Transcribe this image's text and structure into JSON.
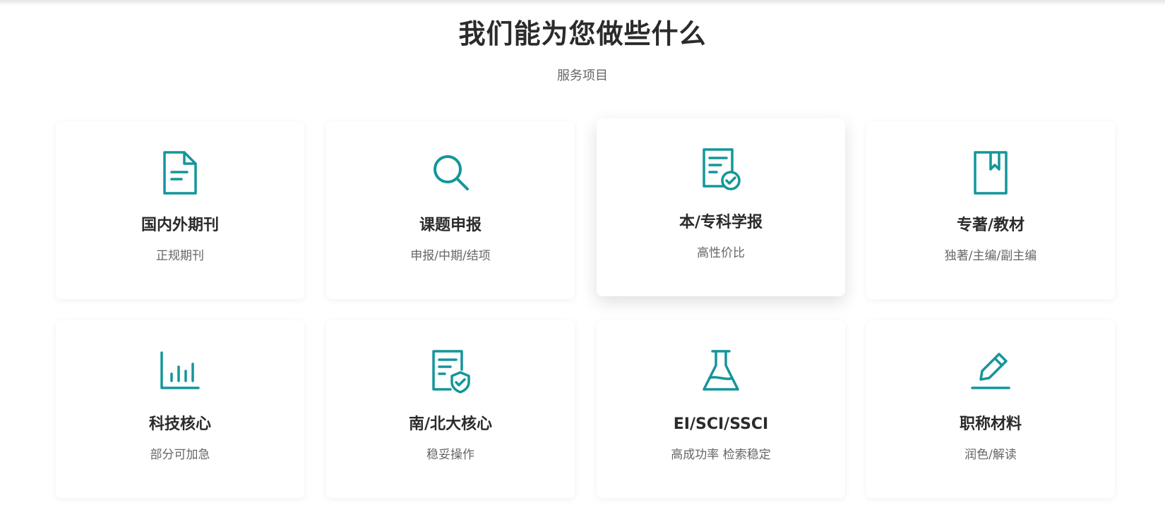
{
  "section": {
    "title": "我们能为您做些什么",
    "subtitle": "服务项目"
  },
  "accent_color": "#13969a",
  "services": [
    {
      "icon": "document-icon",
      "title": "国内外期刊",
      "desc": "正规期刊"
    },
    {
      "icon": "search-icon",
      "title": "课题申报",
      "desc": "申报/中期/结项"
    },
    {
      "icon": "certificate-icon",
      "title": "本/专科学报",
      "desc": "高性价比"
    },
    {
      "icon": "book-icon",
      "title": "专著/教材",
      "desc": "独著/主编/副主编"
    },
    {
      "icon": "bar-chart-icon",
      "title": "科技核心",
      "desc": "部分可加急"
    },
    {
      "icon": "shield-document-icon",
      "title": "南/北大核心",
      "desc": "稳妥操作"
    },
    {
      "icon": "flask-icon",
      "title": "EI/SCI/SSCI",
      "desc": "高成功率 检索稳定"
    },
    {
      "icon": "pencil-icon",
      "title": "职称材料",
      "desc": "润色/解读"
    }
  ]
}
